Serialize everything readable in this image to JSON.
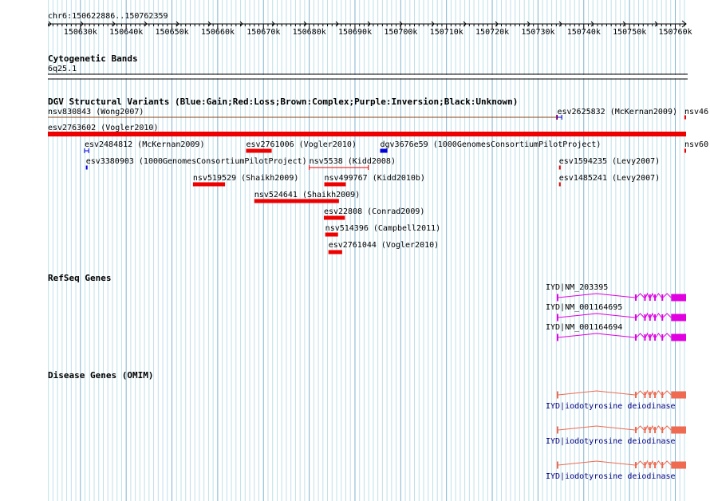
{
  "ruler": {
    "position_label": "chr6:150622886..150762359",
    "ticks": [
      {
        "label": "150630k",
        "kb": 150630
      },
      {
        "label": "150640k",
        "kb": 150640
      },
      {
        "label": "150650k",
        "kb": 150650
      },
      {
        "label": "150660k",
        "kb": 150660
      },
      {
        "label": "150670k",
        "kb": 150670
      },
      {
        "label": "150680k",
        "kb": 150680
      },
      {
        "label": "150690k",
        "kb": 150690
      },
      {
        "label": "150700k",
        "kb": 150700
      },
      {
        "label": "150710k",
        "kb": 150710
      },
      {
        "label": "150720k",
        "kb": 150720
      },
      {
        "label": "150730k",
        "kb": 150730
      },
      {
        "label": "150740k",
        "kb": 150740
      },
      {
        "label": "150750k",
        "kb": 150750
      },
      {
        "label": "150760k",
        "kb": 150760
      }
    ]
  },
  "tracks": {
    "cytoband": {
      "title": "Cytogenetic Bands",
      "band": "6q25.1"
    },
    "dgv": {
      "title": "DGV Structural Variants (Blue:Gain;Red:Loss;Brown:Complex;Purple:Inversion;Black:Unknown)",
      "features": [
        {
          "id": "nsv830843",
          "label": "nsv830843 (Wong2007)",
          "start": 150622886,
          "end": 150734050,
          "kind": "line",
          "color": "#8b4513",
          "row": 0
        },
        {
          "id": "esv2625832",
          "label": "esv2625832 (McKernan2009)",
          "start": 150734200,
          "end": 150735200,
          "kind": "dumbbell",
          "color": "#0000dd",
          "row": 0
        },
        {
          "id": "nsv46",
          "label": "nsv46",
          "start": 150762000,
          "end": 150762359,
          "kind": "box",
          "color": "#ee0000",
          "row": 0
        },
        {
          "id": "esv2763602",
          "label": "esv2763602 (Vogler2010)",
          "start": 150622886,
          "end": 150762359,
          "kind": "box",
          "color": "#ee0000",
          "row": 1
        },
        {
          "id": "esv2484812",
          "label": "esv2484812 (McKernan2009)",
          "start": 150630900,
          "end": 150631800,
          "kind": "dumbbell",
          "color": "#0000dd",
          "row": 2
        },
        {
          "id": "esv2761006",
          "label": "esv2761006 (Vogler2010)",
          "start": 150666200,
          "end": 150671800,
          "kind": "box",
          "color": "#ee0000",
          "row": 2
        },
        {
          "id": "dgv3676e59",
          "label": "dgv3676e59 (1000GenomesConsortiumPilotProject)",
          "start": 150695500,
          "end": 150697100,
          "kind": "box",
          "color": "#0000dd",
          "row": 2
        },
        {
          "id": "nsv60",
          "label": "nsv60",
          "start": 150762000,
          "end": 150762359,
          "kind": "box",
          "color": "#ee0000",
          "row": 2
        },
        {
          "id": "esv3380903",
          "label": "esv3380903 (1000GenomesConsortiumPilotProject)",
          "start": 150631200,
          "end": 150631500,
          "kind": "box",
          "color": "#0000dd",
          "row": 3
        },
        {
          "id": "nsv5538",
          "label": "nsv5538 (Kidd2008)",
          "start": 150680000,
          "end": 150692900,
          "kind": "dumbbell",
          "color": "#ee0000",
          "row": 3
        },
        {
          "id": "esv1594235",
          "label": "esv1594235 (Levy2007)",
          "start": 150734600,
          "end": 150734900,
          "kind": "box",
          "color": "#ee0000",
          "row": 3
        },
        {
          "id": "nsv519529",
          "label": "nsv519529 (Shaikh2009)",
          "start": 150654600,
          "end": 150661600,
          "kind": "box",
          "color": "#ee0000",
          "row": 4
        },
        {
          "id": "nsv499767",
          "label": "nsv499767 (Kidd2010b)",
          "start": 150683300,
          "end": 150688000,
          "kind": "box",
          "color": "#ee0000",
          "row": 4
        },
        {
          "id": "esv1485241",
          "label": "esv1485241 (Levy2007)",
          "start": 150734600,
          "end": 150734900,
          "kind": "box",
          "color": "#ee0000",
          "row": 4
        },
        {
          "id": "nsv524641",
          "label": "nsv524641 (Shaikh2009)",
          "start": 150668000,
          "end": 150686500,
          "kind": "box",
          "color": "#ee0000",
          "row": 5
        },
        {
          "id": "esv22808",
          "label": "esv22808 (Conrad2009)",
          "start": 150683200,
          "end": 150687800,
          "kind": "box",
          "color": "#ee0000",
          "row": 6
        },
        {
          "id": "nsv514396",
          "label": "nsv514396 (Campbell2011)",
          "start": 150683500,
          "end": 150686300,
          "kind": "box",
          "color": "#ee0000",
          "row": 7
        },
        {
          "id": "esv2761044",
          "label": "esv2761044 (Vogler2010)",
          "start": 150684200,
          "end": 150687200,
          "kind": "box",
          "color": "#ee0000",
          "row": 8
        }
      ]
    },
    "refseq": {
      "title": "RefSeq Genes",
      "color": "#e000e0",
      "transcripts": [
        {
          "label": "IYD|NM_203395"
        },
        {
          "label": "IYD|NM_001164695"
        },
        {
          "label": "IYD|NM_001164694"
        }
      ]
    },
    "omim": {
      "title": "Disease Genes (OMIM)",
      "color": "#ee6a50",
      "genes": [
        {
          "label": "IYD|iodotyrosine deiodinase"
        },
        {
          "label": "IYD|iodotyrosine deiodinase"
        },
        {
          "label": "IYD|iodotyrosine deiodinase"
        }
      ]
    }
  }
}
